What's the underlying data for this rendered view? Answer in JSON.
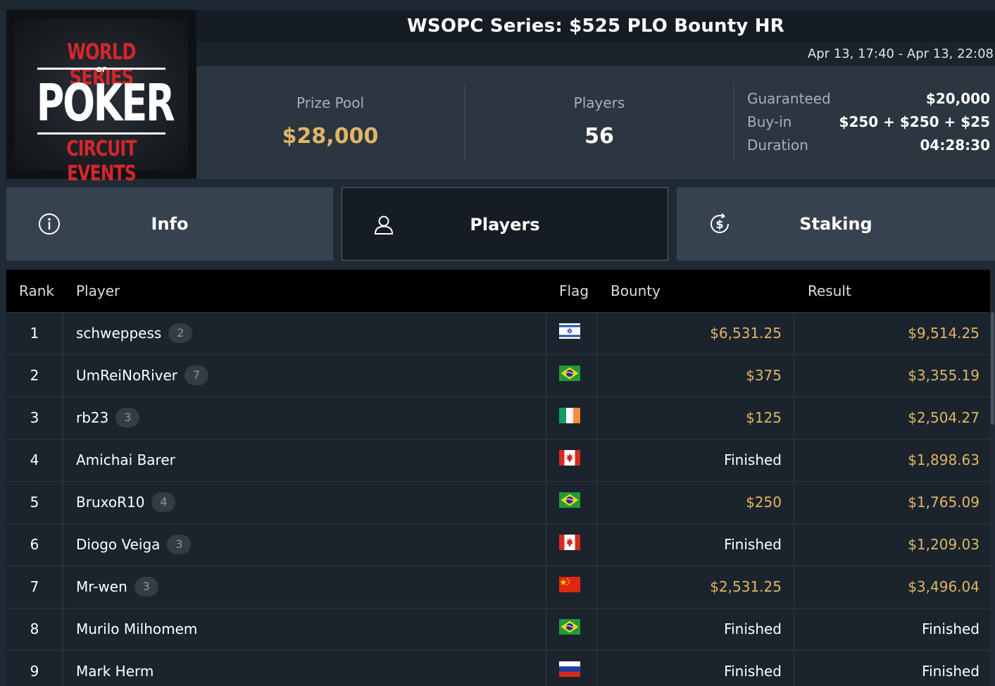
{
  "header": {
    "title": "WSOPC Series: $525 PLO Bounty HR",
    "dates": "Apr 13, 17:40 - Apr 13, 22:08"
  },
  "logo": {
    "line1": "WORLD SERIES",
    "of": "OF",
    "line2": "POKER",
    "line3": "CIRCUIT EVENTS"
  },
  "stats": {
    "prize_pool_label": "Prize Pool",
    "prize_pool_value": "$28,000",
    "players_label": "Players",
    "players_value": "56",
    "guaranteed_label": "Guaranteed",
    "guaranteed_value": "$20,000",
    "buyin_label": "Buy-in",
    "buyin_value": "$250 + $250 + $25",
    "duration_label": "Duration",
    "duration_value": "04:28:30"
  },
  "tabs": [
    {
      "label": "Info",
      "icon": "info-icon"
    },
    {
      "label": "Players",
      "icon": "user-icon",
      "active": true
    },
    {
      "label": "Staking",
      "icon": "dollar-refresh-icon"
    }
  ],
  "table": {
    "headers": {
      "rank": "Rank",
      "player": "Player",
      "flag": "Flag",
      "bounty": "Bounty",
      "result": "Result"
    },
    "rows": [
      {
        "rank": "1",
        "player": "schweppess",
        "badge": "2",
        "flag": "israel",
        "bounty": "$6,531.25",
        "result": "$9,514.25"
      },
      {
        "rank": "2",
        "player": "UmReiNoRiver",
        "badge": "7",
        "flag": "brazil",
        "bounty": "$375",
        "result": "$3,355.19"
      },
      {
        "rank": "3",
        "player": "rb23",
        "badge": "3",
        "flag": "ireland",
        "bounty": "$125",
        "result": "$2,504.27"
      },
      {
        "rank": "4",
        "player": "Amichai Barer",
        "badge": "",
        "flag": "canada",
        "bounty": "Finished",
        "result": "$1,898.63"
      },
      {
        "rank": "5",
        "player": "BruxoR10",
        "badge": "4",
        "flag": "brazil",
        "bounty": "$250",
        "result": "$1,765.09"
      },
      {
        "rank": "6",
        "player": "Diogo Veiga",
        "badge": "3",
        "flag": "canada",
        "bounty": "Finished",
        "result": "$1,209.03"
      },
      {
        "rank": "7",
        "player": "Mr-wen",
        "badge": "3",
        "flag": "china",
        "bounty": "$2,531.25",
        "result": "$3,496.04"
      },
      {
        "rank": "8",
        "player": "Murilo Milhomem",
        "badge": "",
        "flag": "brazil",
        "bounty": "Finished",
        "result": "Finished"
      },
      {
        "rank": "9",
        "player": "Mark Herm",
        "badge": "",
        "flag": "russia",
        "bounty": "Finished",
        "result": "Finished"
      }
    ]
  },
  "colors": {
    "gold": "#e1b565",
    "row_bg": "#1b242d",
    "tab_bg": "#36424e",
    "active_tab_bg": "#151c24"
  }
}
